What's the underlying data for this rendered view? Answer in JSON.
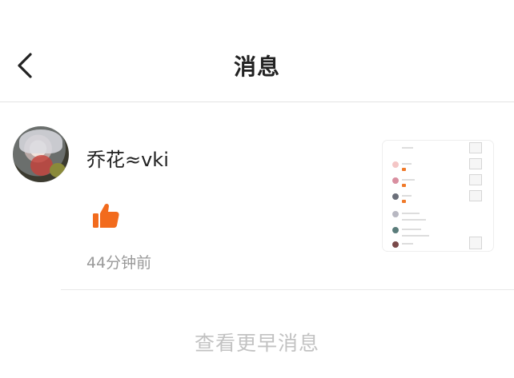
{
  "header": {
    "title": "消息"
  },
  "messages": [
    {
      "username": "乔花≈vki",
      "time": "44分钟前"
    }
  ],
  "footer": {
    "more_label": "查看更早消息"
  },
  "colors": {
    "like": "#F26B1D",
    "muted": "#999999",
    "divider": "#E3E3E3"
  }
}
